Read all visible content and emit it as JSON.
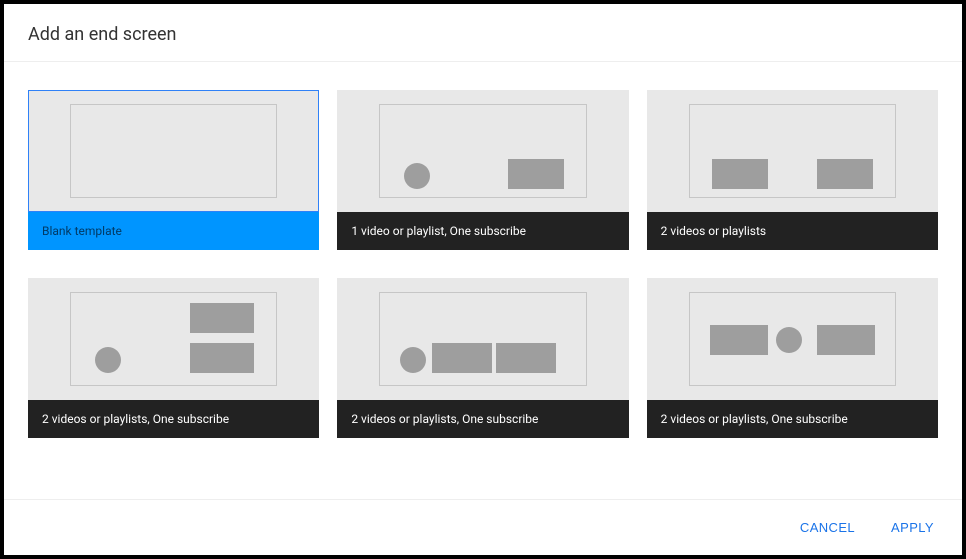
{
  "dialog": {
    "title": "Add an end screen"
  },
  "templates": [
    {
      "label": "Blank template",
      "selected": true,
      "layout": "blank"
    },
    {
      "label": "1 video or playlist, One subscribe",
      "selected": false,
      "layout": "circ-left-rect-right"
    },
    {
      "label": "2 videos or playlists",
      "selected": false,
      "layout": "two-rect"
    },
    {
      "label": "2 videos or playlists, One subscribe",
      "selected": false,
      "layout": "circ-left-two-rect-stack"
    },
    {
      "label": "2 videos or playlists, One subscribe",
      "selected": false,
      "layout": "circ-two-rect-row"
    },
    {
      "label": "2 videos or playlists, One subscribe",
      "selected": false,
      "layout": "rect-circ-rect"
    }
  ],
  "footer": {
    "cancel": "CANCEL",
    "apply": "APPLY"
  }
}
